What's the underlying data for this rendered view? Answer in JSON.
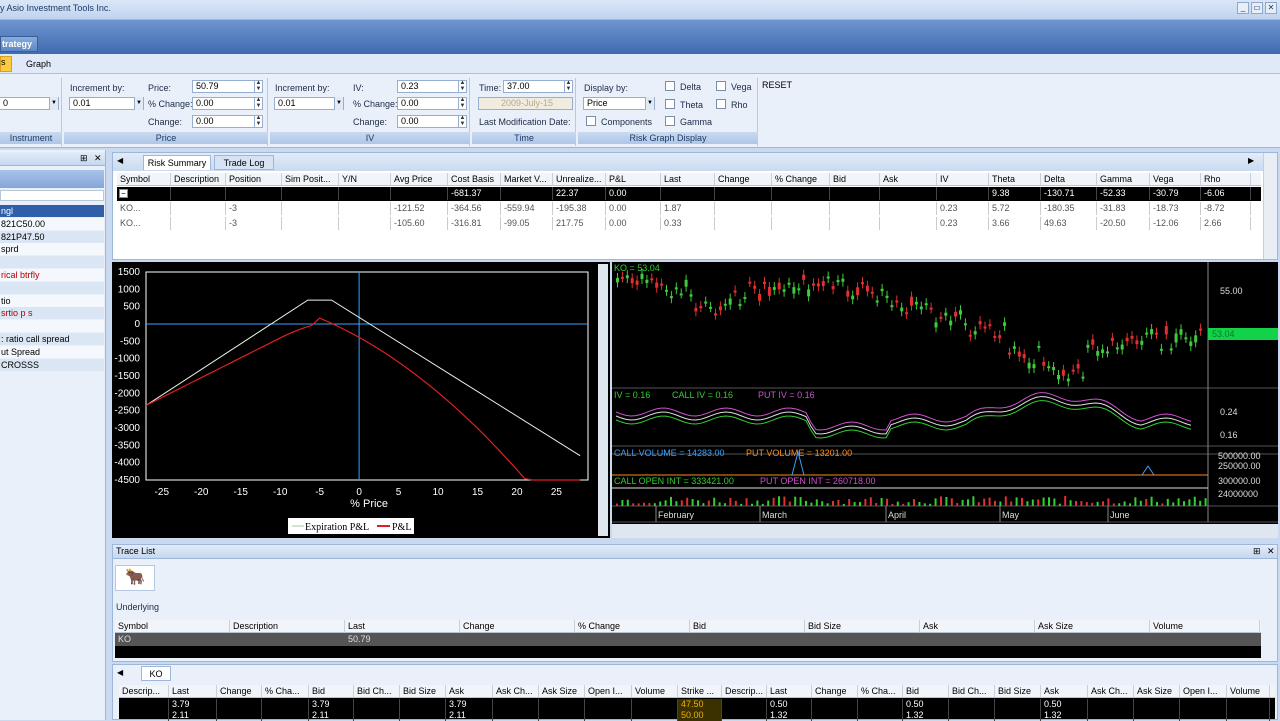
{
  "app": {
    "title": "y Asio Investment Tools Inc.",
    "min": "_",
    "restore": "▭",
    "close": "✕"
  },
  "ribbon": {
    "tab_active": "trategy",
    "subtab_active": "s",
    "subtab_graph": "Graph",
    "instrument": {
      "caption": "Instrument",
      "value": "0"
    },
    "price": {
      "caption": "Price",
      "increment_label": "Increment by:",
      "increment": "0.01",
      "price_label": "Price:",
      "price": "50.79",
      "pct_label": "% Change:",
      "pct": "0.00",
      "change_label": "Change:",
      "change": "0.00"
    },
    "iv": {
      "caption": "IV",
      "increment_label": "Increment by:",
      "increment": "0.01",
      "iv_label": "IV:",
      "iv": "0.23",
      "pct_label": "% Change:",
      "pct": "0.00",
      "change_label": "Change:",
      "change": "0.00"
    },
    "time": {
      "caption": "Time",
      "time_label": "Time:",
      "time": "37.00",
      "date": "2009-July-15",
      "lastmod_label": "Last Modification Date:"
    },
    "display": {
      "caption": "Risk Graph Display",
      "display_label": "Display by:",
      "display_value": "Price",
      "components": "Components",
      "delta": "Delta",
      "theta": "Theta",
      "gamma": "Gamma",
      "vega": "Vega",
      "rho": "Rho"
    },
    "reset": "RESET"
  },
  "left_panel": {
    "pin": "⊞",
    "close": "✕",
    "items": [
      "ngl",
      "821C50.00",
      "821P47.50",
      "sprd",
      "",
      "rical btrfly",
      "",
      "tio",
      "srtio p s",
      "",
      ": ratio call spread",
      "ut Spread",
      "CROSSS"
    ]
  },
  "risk": {
    "tabs": [
      "Risk Summary",
      "Trade Log"
    ],
    "columns": [
      "Symbol",
      "Description",
      "Position",
      "Sim Posit...",
      "Y/N",
      "Avg Price",
      "Cost Basis",
      "Market V...",
      "Unrealize...",
      "P&L",
      "Last",
      "Change",
      "% Change",
      "Bid",
      "Ask",
      "IV",
      "Theta",
      "Delta",
      "Gamma",
      "Vega",
      "Rho"
    ],
    "rows": [
      [
        "",
        "",
        "",
        "",
        "",
        "",
        "-681.37",
        "",
        "22.37",
        "0.00",
        "",
        "",
        "",
        "",
        "",
        "",
        "9.38",
        "-130.71",
        "-52.33",
        "-30.79",
        "-6.06"
      ],
      [
        "KO...",
        "",
        "-3",
        "",
        "",
        "-121.52",
        "-364.56",
        "-559.94",
        "-195.38",
        "0.00",
        "1.87",
        "",
        "",
        "",
        "",
        "0.23",
        "5.72",
        "-180.35",
        "-31.83",
        "-18.73",
        "-8.72"
      ],
      [
        "KO...",
        "",
        "-3",
        "",
        "",
        "-105.60",
        "-316.81",
        "-99.05",
        "217.75",
        "0.00",
        "0.33",
        "",
        "",
        "",
        "",
        "0.23",
        "3.66",
        "49.63",
        "-20.50",
        "-12.06",
        "2.66"
      ]
    ]
  },
  "pnl_chart": {
    "yticks": [
      "1500",
      "1000",
      "500",
      "0",
      "-500",
      "-1000",
      "-1500",
      "-2000",
      "-2500",
      "-3000",
      "-3500",
      "-4000",
      "-4500"
    ],
    "xticks": [
      "-25",
      "-20",
      "-15",
      "-10",
      "-5",
      "0",
      "5",
      "10",
      "15",
      "20",
      "25"
    ],
    "xlabel": "% Price",
    "legend": [
      "Expiration P&L",
      "P&L"
    ]
  },
  "stock_chart": {
    "price_label": "KO = 53.04",
    "price_axis": [
      "55.00"
    ],
    "current_price": "53.04",
    "iv_label": "IV = 0.16",
    "call_iv": "CALL IV = 0.16",
    "put_iv": "PUT IV = 0.16",
    "iv_axis": [
      "0.24",
      "0.16"
    ],
    "call_vol": "CALL VOLUME = 14283.00",
    "put_vol": "PUT VOLUME = 13201.00",
    "vol_axis": [
      "500000.00",
      "250000.00"
    ],
    "call_oi": "CALL OPEN INT = 333421.00",
    "put_oi": "PUT OPEN INT = 260718.00",
    "oi_axis": [
      "300000.00",
      "24000000"
    ],
    "months": [
      "February",
      "March",
      "April",
      "May",
      "June"
    ]
  },
  "trace": {
    "title": "Trace List",
    "underlying_label": "Underlying",
    "columns": [
      "Symbol",
      "Description",
      "Last",
      "Change",
      "% Change",
      "Bid",
      "Bid Size",
      "Ask",
      "Ask Size",
      "Volume"
    ],
    "row": [
      "KO",
      "",
      "50.79",
      "",
      "",
      "",
      "",
      "",
      "",
      ""
    ]
  },
  "chain": {
    "tab": "KO",
    "columns": [
      "Descrip...",
      "Last",
      "Change",
      "% Cha...",
      "Bid",
      "Bid Ch...",
      "Bid Size",
      "Ask",
      "Ask Ch...",
      "Ask Size",
      "Open I...",
      "Volume",
      "Strike ...",
      "Descrip...",
      "Last",
      "Change",
      "% Cha...",
      "Bid",
      "Bid Ch...",
      "Bid Size",
      "Ask",
      "Ask Ch...",
      "Ask Size",
      "Open I...",
      "Volume"
    ],
    "rows": [
      [
        "",
        "3.79",
        "",
        "",
        "3.79",
        "",
        "",
        "3.79",
        "",
        "",
        "",
        "",
        "47.50",
        "",
        "0.50",
        "",
        "",
        "0.50",
        "",
        "",
        "0.50",
        "",
        "",
        "",
        ""
      ],
      [
        "",
        "2.11",
        "",
        "",
        "2.11",
        "",
        "",
        "2.11",
        "",
        "",
        "",
        "",
        "50.00",
        "",
        "1.32",
        "",
        "",
        "1.32",
        "",
        "",
        "1.32",
        "",
        "",
        "",
        ""
      ]
    ]
  }
}
